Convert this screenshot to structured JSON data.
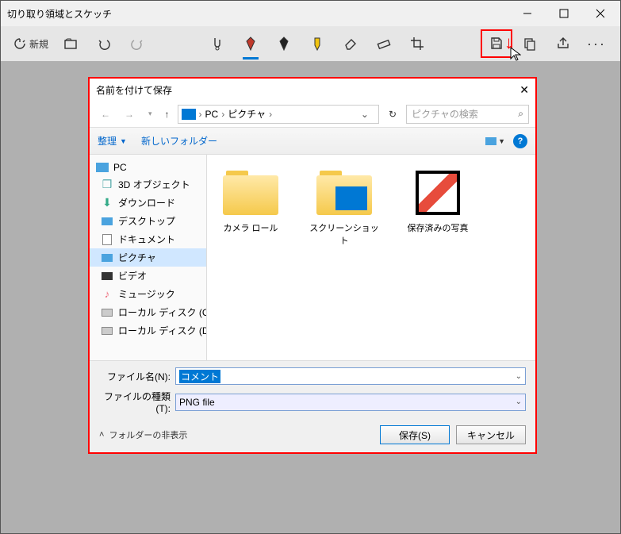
{
  "window": {
    "title": "切り取り領域とスケッチ",
    "new_label": "新規"
  },
  "dialog": {
    "title": "名前を付けて保存",
    "breadcrumb": {
      "root": "PC",
      "folder": "ピクチャ"
    },
    "search_placeholder": "ピクチャの検索",
    "organize": "整理",
    "new_folder": "新しいフォルダー",
    "tree": {
      "pc": "PC",
      "items": [
        "3D オブジェクト",
        "ダウンロード",
        "デスクトップ",
        "ドキュメント",
        "ピクチャ",
        "ビデオ",
        "ミュージック",
        "ローカル ディスク (C",
        "ローカル ディスク (D"
      ]
    },
    "folders": [
      "カメラ ロール",
      "スクリーンショット",
      "保存済みの写真"
    ],
    "filename_label": "ファイル名(N):",
    "filename_value": "コメント",
    "filetype_label": "ファイルの種類(T):",
    "filetype_value": "PNG file",
    "folders_hide": "フォルダーの非表示",
    "save": "保存(S)",
    "cancel": "キャンセル"
  }
}
